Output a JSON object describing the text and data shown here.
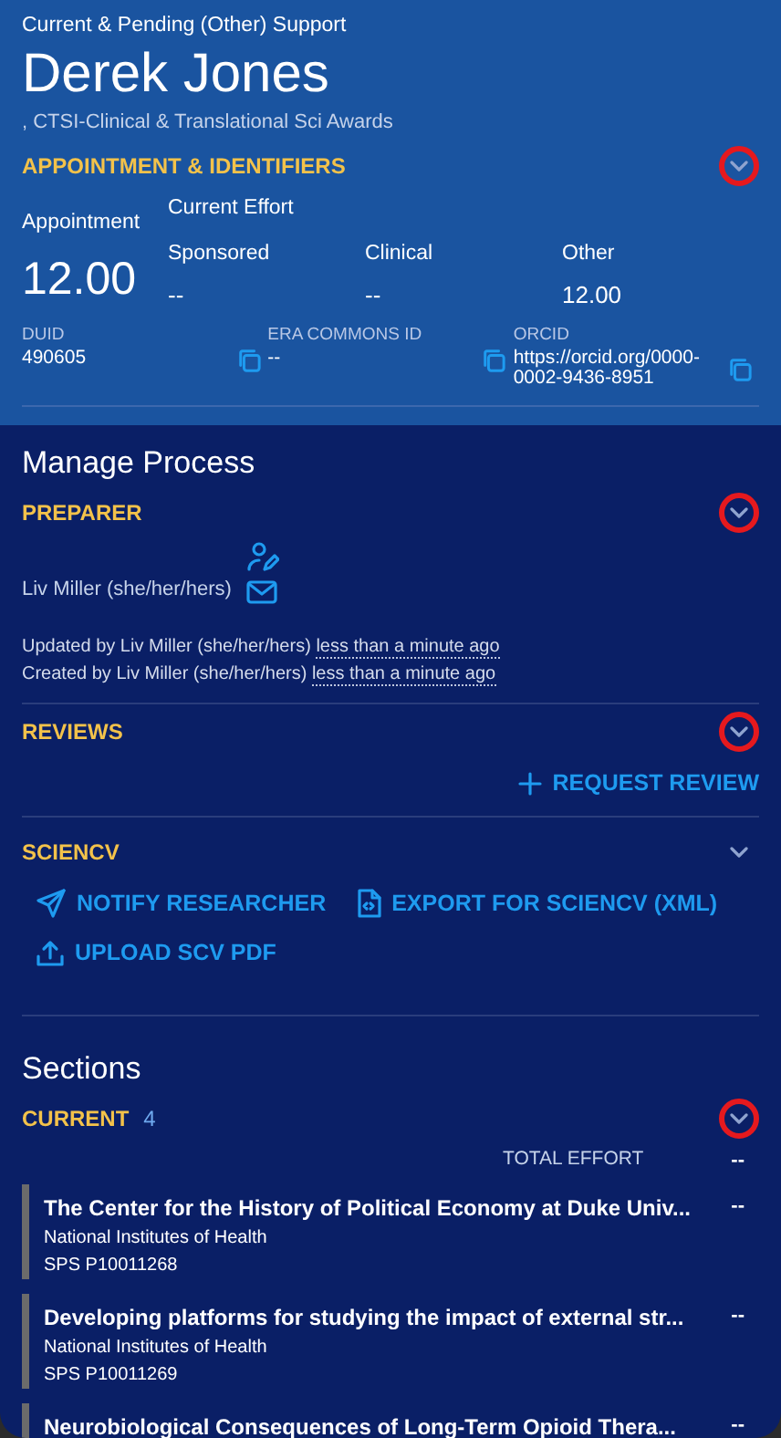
{
  "header": {
    "supertitle": "Current & Pending (Other) Support",
    "name": "Derek Jones",
    "affiliation": ", CTSI-Clinical & Translational Sci Awards",
    "appointment_section": {
      "title": "APPOINTMENT & IDENTIFIERS",
      "highlighted": true
    },
    "appointment": {
      "label": "Appointment",
      "value": "12.00"
    },
    "current_effort": {
      "label": "Current Effort",
      "columns": [
        {
          "label": "Sponsored",
          "value": "--"
        },
        {
          "label": "Clinical",
          "value": "--"
        },
        {
          "label": "Other",
          "value": "12.00"
        }
      ]
    },
    "identifiers": [
      {
        "label": "DUID",
        "value": "490605"
      },
      {
        "label": "ERA COMMONS ID",
        "value": "--"
      },
      {
        "label": "ORCID",
        "value": "https://orcid.org/0000-0002-9436-8951"
      }
    ]
  },
  "manage_process": {
    "title": "Manage Process",
    "preparer": {
      "title": "PREPARER",
      "highlighted": true,
      "person": "Liv Miller (she/her/hers)",
      "history": [
        {
          "text": "Updated by Liv Miller (she/her/hers)",
          "when": "less than a minute ago"
        },
        {
          "text": "Created by Liv Miller (she/her/hers)",
          "when": "less than a minute ago"
        }
      ]
    },
    "reviews": {
      "title": "REVIEWS",
      "highlighted": true,
      "actions": [
        {
          "kind": "plus",
          "label": "REQUEST REVIEW"
        }
      ]
    },
    "sciencv": {
      "title": "SCIENCV",
      "highlighted": false,
      "actions": [
        {
          "kind": "send",
          "label": "NOTIFY RESEARCHER"
        },
        {
          "kind": "file",
          "label": "EXPORT FOR SCIENCV (XML)"
        },
        {
          "kind": "upload",
          "label": "UPLOAD SCV PDF"
        }
      ]
    }
  },
  "sections": {
    "title": "Sections",
    "current": {
      "title": "CURRENT",
      "count": "4",
      "highlighted": true,
      "total_label": "TOTAL EFFORT",
      "total_value": "--",
      "items": [
        {
          "title": "The Center for the History of Political Economy at Duke Univ...",
          "sponsor": "National Institutes of Health",
          "id": "SPS P10011268",
          "effort": "--"
        },
        {
          "title": "Developing platforms for studying the impact of external str...",
          "sponsor": "National Institutes of Health",
          "id": "SPS P10011269",
          "effort": "--"
        },
        {
          "title": "Neurobiological Consequences of Long-Term Opioid Thera...",
          "effort": "--"
        }
      ]
    }
  }
}
